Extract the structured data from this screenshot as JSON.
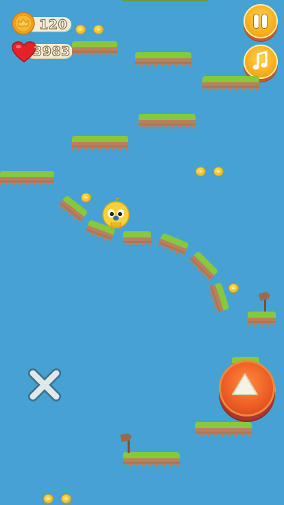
{
  "hud": {
    "coins": "120",
    "lives": "3983",
    "coin_icon": "crown-coin-icon",
    "heart_icon": "heart-icon"
  },
  "buttons": {
    "pause_icon": "pause-icon",
    "music_icon": "music-note-icon",
    "jump_icon": "up-arrow-icon",
    "close_icon": "close-icon"
  },
  "colors": {
    "sky": "#45a2d3",
    "grass": "#86c83e",
    "dirt": "#b98060",
    "button_orange": "#f6a818",
    "jump_red": "#ec5b25"
  }
}
